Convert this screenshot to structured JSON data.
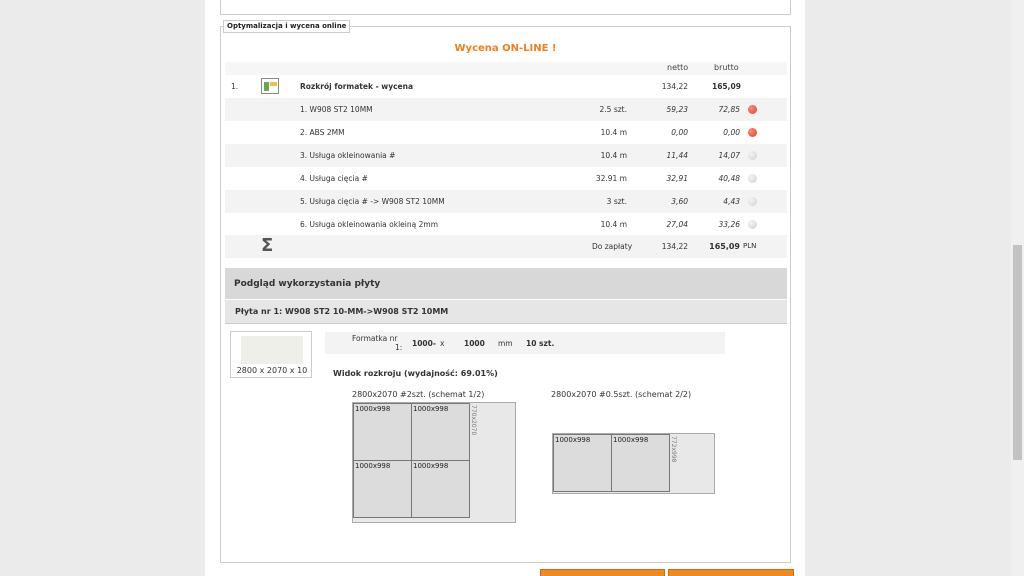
{
  "fieldset_legend": "Optymalizacja i wycena online",
  "title": "Wycena ON-LINE !",
  "headers": {
    "netto": "netto",
    "brutto": "brutto"
  },
  "main_item": {
    "number": "1.",
    "name": "Rozkrój formatek - wycena",
    "netto": "134,22",
    "brutto": "165,09"
  },
  "items": [
    {
      "name": "1. W908 ST2 10MM",
      "qty": "2.5 szt.",
      "netto": "59,23",
      "brutto": "72,85",
      "status": "red"
    },
    {
      "name": "2. ABS 2MM",
      "qty": "10.4  m",
      "netto": "0,00",
      "brutto": "0,00",
      "status": "red"
    },
    {
      "name": "3. Usługa okleinowania #",
      "qty": "10.4  m",
      "netto": "11,44",
      "brutto": "14,07",
      "status": "gray"
    },
    {
      "name": "4. Usługa cięcia #",
      "qty": "32.91  m",
      "netto": "32,91",
      "brutto": "40,48",
      "status": "gray"
    },
    {
      "name": "5. Usługa cięcia # -> W908 ST2 10MM",
      "qty": "3  szt.",
      "netto": "3,60",
      "brutto": "4,43",
      "status": "gray"
    },
    {
      "name": "6. Usługa okleinowania okleiną 2mm",
      "qty": "10.4  m",
      "netto": "27,04",
      "brutto": "33,26",
      "status": "gray"
    }
  ],
  "summary": {
    "label": "Do zapłaty",
    "netto": "134,22",
    "brutto": "165,09",
    "currency": "PLN"
  },
  "preview_title": "Podgląd wykorzystania płyty",
  "plate_title": "Płyta nr 1: W908 ST2 10-MM->W908 ST2 10MM",
  "thumb_caption": "2800 x 2070 x 10",
  "formatka": {
    "label_line1": "Formatka nr",
    "label_line2": "1:",
    "width": "1000-",
    "times": "x",
    "height": "1000",
    "unit": "mm",
    "count": "10 szt."
  },
  "widok": "Widok rozkroju (wydajność: 69.01%)",
  "schemes": [
    {
      "label": "2800x2070 #2szt. (schemat 1/2)",
      "pieces": [
        "1000x998",
        "1000x998",
        "1000x998",
        "1000x998"
      ],
      "offcut": "770x2070"
    },
    {
      "label": "2800x2070 #0.5szt. (schemat 2/2)",
      "pieces": [
        "1000x998",
        "1000x998"
      ],
      "offcut": "772x998"
    }
  ],
  "colors": {
    "accent": "#f07f1e",
    "status_red": "#e0402a",
    "button": "#f08a24"
  }
}
